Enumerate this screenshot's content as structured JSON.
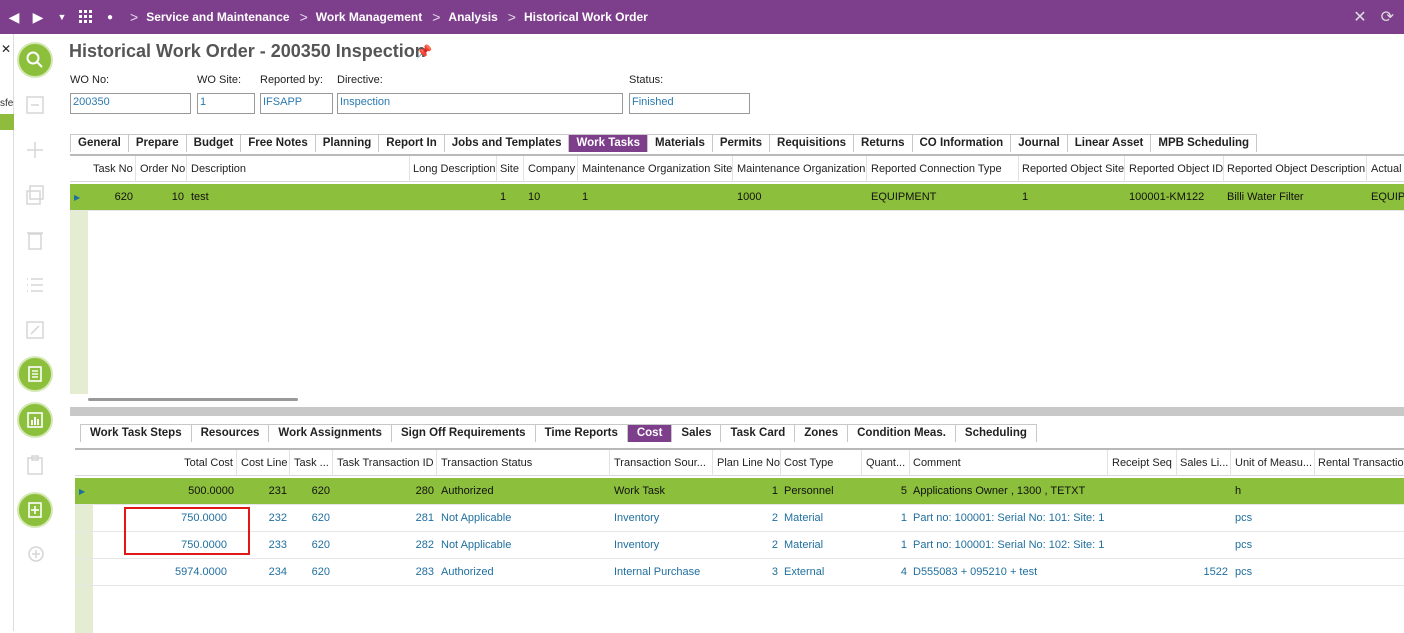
{
  "breadcrumb": [
    "Service and Maintenance",
    "Work Management",
    "Analysis",
    "Historical Work Order"
  ],
  "left_strip_text": "sfe",
  "page_title": "Historical Work Order - 200350 Inspection",
  "fields": {
    "wo_no": {
      "label": "WO No:",
      "value": "200350"
    },
    "wo_site": {
      "label": "WO Site:",
      "value": "1"
    },
    "reported_by": {
      "label": "Reported by:",
      "value": "IFSAPP"
    },
    "directive": {
      "label": "Directive:",
      "value": "Inspection"
    },
    "status": {
      "label": "Status:",
      "value": "Finished"
    }
  },
  "main_tabs": [
    "General",
    "Prepare",
    "Budget",
    "Free Notes",
    "Planning",
    "Report In",
    "Jobs and Templates",
    "Work Tasks",
    "Materials",
    "Permits",
    "Requisitions",
    "Returns",
    "CO Information",
    "Journal",
    "Linear Asset",
    "MPB Scheduling"
  ],
  "main_tab_active": "Work Tasks",
  "tasks_grid": {
    "columns": [
      "Task No",
      "Order No",
      "Description",
      "Long Description",
      "Site",
      "Company",
      "Maintenance Organization Site",
      "Maintenance Organization",
      "Reported Connection Type",
      "Reported Object Site",
      "Reported Object ID",
      "Reported Object Description",
      "Actual"
    ],
    "rows": [
      {
        "task_no": "620",
        "order_no": "10",
        "description": "test",
        "long_description": "",
        "site": "1",
        "company": "10",
        "mo_site": "1",
        "mo": "1000",
        "conn_type": "EQUIPMENT",
        "obj_site": "1",
        "obj_id": "100001-KM122",
        "obj_desc": "Billi Water Filter",
        "actual": "EQUIPM"
      }
    ]
  },
  "sub_tabs": [
    "Work Task Steps",
    "Resources",
    "Work Assignments",
    "Sign Off Requirements",
    "Time Reports",
    "Cost",
    "Sales",
    "Task Card",
    "Zones",
    "Condition Meas.",
    "Scheduling"
  ],
  "sub_tab_active": "Cost",
  "cost_grid": {
    "columns": [
      "Total Cost",
      "Cost Line",
      "Task ...",
      "Task Transaction ID",
      "Transaction Status",
      "Transaction Sour...",
      "Plan Line No",
      "Cost Type",
      "Quant...",
      "Comment",
      "Receipt Seq",
      "Sales Li...",
      "Unit of Measu...",
      "Rental Transactio"
    ],
    "rows": [
      {
        "total_cost": "500.0000",
        "cost_line": "231",
        "task": "620",
        "trans_id": "280",
        "status": "Authorized",
        "source": "Work Task",
        "plan_line": "1",
        "cost_type": "Personnel",
        "qty": "5",
        "comment": "Applications Owner , 1300 , TETXT",
        "receipt": "",
        "sales": "",
        "uom": "h"
      },
      {
        "total_cost": "750.0000",
        "cost_line": "232",
        "task": "620",
        "trans_id": "281",
        "status": "Not Applicable",
        "source": "Inventory",
        "plan_line": "2",
        "cost_type": "Material",
        "qty": "1",
        "comment": "Part no: 100001: Serial No: 101: Site: 1",
        "receipt": "",
        "sales": "",
        "uom": "pcs"
      },
      {
        "total_cost": "750.0000",
        "cost_line": "233",
        "task": "620",
        "trans_id": "282",
        "status": "Not Applicable",
        "source": "Inventory",
        "plan_line": "2",
        "cost_type": "Material",
        "qty": "1",
        "comment": "Part no: 100001: Serial No: 102: Site: 1",
        "receipt": "",
        "sales": "",
        "uom": "pcs"
      },
      {
        "total_cost": "5974.0000",
        "cost_line": "234",
        "task": "620",
        "trans_id": "283",
        "status": "Authorized",
        "source": "Internal Purchase",
        "plan_line": "3",
        "cost_type": "External",
        "qty": "4",
        "comment": "D555083 + 095210 + test",
        "receipt": "",
        "sales": "1522",
        "uom": "pcs"
      }
    ]
  },
  "colors": {
    "brand": "#7d3f8c",
    "highlight": "#8cbf3c",
    "annotation": "#e01818"
  }
}
